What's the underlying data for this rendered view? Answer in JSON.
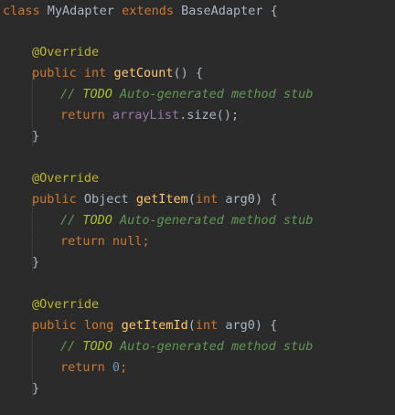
{
  "code": {
    "class_line": {
      "kw_class": "class",
      "name": "MyAdapter",
      "kw_extends": "extends",
      "base": "BaseAdapter",
      "brace": "{"
    },
    "method1": {
      "annotation": "@Override",
      "kw_public": "public",
      "ret_type": "int",
      "name": "getCount",
      "params": "() {",
      "comment_slashes": "// ",
      "comment_todo": "TODO",
      "comment_rest": " Auto-generated method stub",
      "kw_return": "return",
      "field": "arrayList",
      "tail": ".size();",
      "close": "}"
    },
    "method2": {
      "annotation": "@Override",
      "kw_public": "public",
      "ret_type": "Object",
      "name": "getItem",
      "paren_open": "(",
      "param_type": "int",
      "param_name": "arg0",
      "paren_close": ") {",
      "comment_slashes": "// ",
      "comment_todo": "TODO",
      "comment_rest": " Auto-generated method stub",
      "kw_return": "return",
      "value": "null",
      "semi": ";",
      "close": "}"
    },
    "method3": {
      "annotation": "@Override",
      "kw_public": "public",
      "ret_type": "long",
      "name": "getItemId",
      "paren_open": "(",
      "param_type": "int",
      "param_name": "arg0",
      "paren_close": ") {",
      "comment_slashes": "// ",
      "comment_todo": "TODO",
      "comment_rest": " Auto-generated method stub",
      "kw_return": "return",
      "value": "0",
      "semi": ";",
      "close": "}"
    }
  },
  "colors": {
    "background": "#2b2b2b",
    "keyword": "#cc7832",
    "annotation": "#bbb529",
    "method_name": "#ffc66d",
    "field": "#9876aa",
    "number": "#6897bb",
    "comment": "#629755",
    "text": "#a9b7c6"
  }
}
